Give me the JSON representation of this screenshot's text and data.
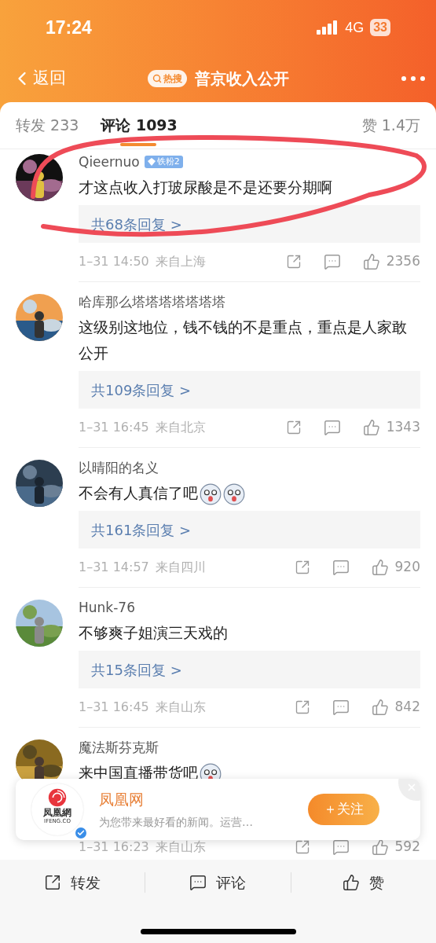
{
  "status_bar": {
    "time": "17:24",
    "network": "4G",
    "battery": "33"
  },
  "nav": {
    "back": "返回",
    "hot_badge": "热搜",
    "title": "普京收入公开"
  },
  "tabs": [
    {
      "label": "转发 233",
      "selected": false
    },
    {
      "label": "评论 1093",
      "selected": true
    },
    {
      "label": "赞 1.4万",
      "selected": false
    }
  ],
  "comments": [
    {
      "user": "Qieernuo",
      "badge": "铁粉2",
      "body": [
        {
          "kind": "text",
          "text": "才这点收入打玻尿酸是不是还要分期啊"
        }
      ],
      "replies": "共68条回复 >",
      "time": "1–31 14:50",
      "location": "来自上海",
      "likes": "2356"
    },
    {
      "user": "哈库那么塔塔塔塔塔塔塔",
      "body": [
        {
          "kind": "text",
          "text": "这级别这地位，钱不钱的不是重点，重点是人家敢公开"
        }
      ],
      "replies": "共109条回复 >",
      "time": "1–31 16:45",
      "location": "来自北京",
      "likes": "1343"
    },
    {
      "user": "以晴阳的名义",
      "body": [
        {
          "kind": "text",
          "text": "不会有人真信了吧"
        },
        {
          "kind": "emoji"
        },
        {
          "kind": "emoji"
        }
      ],
      "replies": "共161条回复 >",
      "time": "1–31 14:57",
      "location": "来自四川",
      "likes": "920"
    },
    {
      "user": "Hunk-76",
      "body": [
        {
          "kind": "text",
          "text": "不够爽子姐演三天戏的"
        }
      ],
      "replies": "共15条回复 >",
      "time": "1–31 16:45",
      "location": "来自山东",
      "likes": "842"
    },
    {
      "user": "魔法斯芬克斯",
      "body": [
        {
          "kind": "text",
          "text": "来中国直播带货吧"
        },
        {
          "kind": "emoji"
        }
      ],
      "time": "1–31 16:23",
      "location": "来自山东",
      "likes": "592"
    }
  ],
  "popup": {
    "logo_text": "凤凰網",
    "logo_subtext": "IFENG.CO",
    "name": "凤凰网",
    "description": "为您带来最好看的新闻。运营…",
    "follow": "＋关注"
  },
  "bottom_bar": [
    {
      "kind": "repost",
      "label": "转发"
    },
    {
      "kind": "comment",
      "label": "评论"
    },
    {
      "kind": "like",
      "label": "赞"
    }
  ]
}
